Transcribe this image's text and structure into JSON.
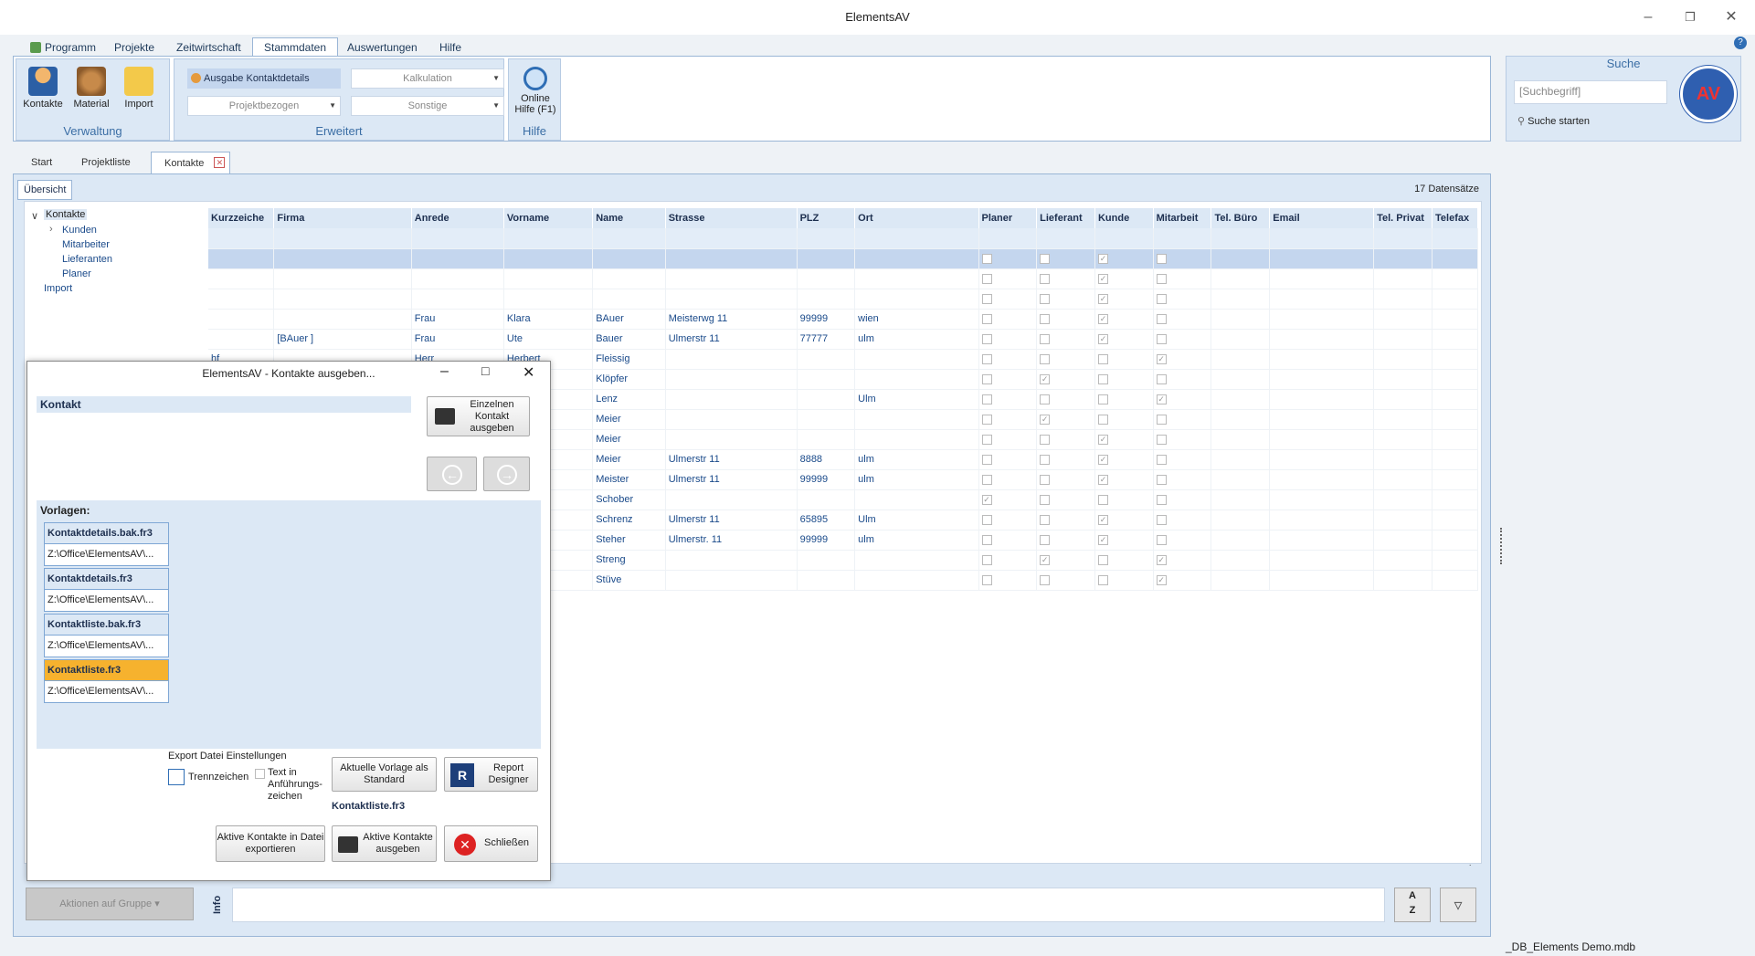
{
  "window": {
    "title": "ElementsAV"
  },
  "menu": [
    "Programm",
    "Projekte",
    "Zeitwirtschaft",
    "Stammdaten",
    "Auswertungen",
    "Hilfe"
  ],
  "ribbon": {
    "verwaltung": {
      "label": "Verwaltung",
      "buttons": [
        "Kontakte",
        "Material",
        "Import"
      ]
    },
    "erweitert": {
      "label": "Erweitert",
      "ausgabe": "Ausgabe Kontaktdetails",
      "kalkulation": "Kalkulation",
      "projektbezogen": "Projektbezogen",
      "sonstige": "Sonstige"
    },
    "hilfe": {
      "label": "Hilfe",
      "online": "Online Hilfe (F1)"
    }
  },
  "search": {
    "title": "Suche",
    "placeholder": "[Suchbegriff]",
    "start": "Suche starten"
  },
  "tabs": [
    "Start",
    "Projektliste",
    "Kontakte"
  ],
  "overview": {
    "tab": "Übersicht",
    "count": "17 Datensätze"
  },
  "tree": {
    "root": "Kontakte",
    "items": [
      "Kunden",
      "Mitarbeiter",
      "Lieferanten",
      "Planer"
    ],
    "import": "Import"
  },
  "grid": {
    "headers": [
      "Kurzzeiche",
      "Firma",
      "Anrede",
      "Vorname",
      "Name",
      "Strasse",
      "PLZ",
      "Ort",
      "Planer",
      "Lieferant",
      "Kunde",
      "Mitarbeit",
      "Tel. Büro",
      "Email",
      "Tel. Privat",
      "Telefax"
    ],
    "rows": [
      [
        "",
        "",
        "",
        "",
        "",
        "",
        "",
        "",
        "",
        "",
        "x",
        ""
      ],
      [
        "",
        "",
        "",
        "",
        "",
        "",
        "",
        "",
        "",
        "",
        "x",
        ""
      ],
      [
        "",
        "",
        "Frau",
        "Klara",
        "BAuer",
        "Meisterwg 11",
        "99999",
        "wien",
        "",
        "",
        "x",
        ""
      ],
      [
        "",
        "[BAuer ]",
        "Frau",
        "Ute",
        "Bauer",
        "Ulmerstr 11",
        "77777",
        "ulm",
        "",
        "",
        "x",
        ""
      ],
      [
        "hf",
        "",
        "Herr",
        "Herbert",
        "Fleissig",
        "",
        "",
        "",
        "",
        "",
        "",
        "x"
      ],
      [
        "",
        "",
        "",
        "",
        "Klöpfer",
        "",
        "",
        "",
        "",
        "x",
        "",
        ""
      ],
      [
        "",
        "",
        "",
        "",
        "Lenz",
        "",
        "",
        "Ulm",
        "",
        "",
        "",
        "x"
      ],
      [
        "",
        "",
        "",
        "",
        "Meier",
        "",
        "",
        "",
        "",
        "x",
        "",
        ""
      ],
      [
        "",
        "",
        "",
        "",
        "Meier",
        "",
        "",
        "",
        "",
        "",
        "x",
        ""
      ],
      [
        "",
        "",
        "",
        "",
        "Meier",
        "Ulmerstr 11",
        "8888",
        "ulm",
        "",
        "",
        "x",
        ""
      ],
      [
        "",
        "",
        "",
        "",
        "Meister",
        "Ulmerstr 11",
        "99999",
        "ulm",
        "",
        "",
        "x",
        ""
      ],
      [
        "",
        "",
        "",
        "",
        "Schober",
        "",
        "",
        "",
        "x",
        "",
        "",
        ""
      ],
      [
        "",
        "",
        "",
        "",
        "Schrenz",
        "Ulmerstr 11",
        "65895",
        "Ulm",
        "",
        "",
        "x",
        ""
      ],
      [
        "",
        "",
        "",
        "",
        "Steher",
        "Ulmerstr. 11",
        "99999",
        "ulm",
        "",
        "",
        "x",
        ""
      ],
      [
        "",
        "",
        "",
        "",
        "Streng",
        "",
        "",
        "",
        "",
        "x",
        "",
        "x"
      ],
      [
        "",
        "",
        "",
        "",
        "Stüve",
        "",
        "",
        "",
        "",
        "",
        "",
        "x"
      ]
    ]
  },
  "dialog": {
    "title": "ElementsAV - Kontakte ausgeben...",
    "kontakt_label": "Kontakt",
    "einzeln": "Einzelnen Kontakt ausgeben",
    "vorlagen": "Vorlagen:",
    "templates": [
      {
        "name": "Kontaktdetails.bak.fr3",
        "path": "Z:\\Office\\ElementsAV\\..."
      },
      {
        "name": "Kontaktdetails.fr3",
        "path": "Z:\\Office\\ElementsAV\\..."
      },
      {
        "name": "Kontaktliste.bak.fr3",
        "path": "Z:\\Office\\ElementsAV\\..."
      },
      {
        "name": "Kontaktliste.fr3",
        "path": "Z:\\Office\\ElementsAV\\..."
      }
    ],
    "export_label": "Export Datei Einstellungen",
    "trennzeichen": "Trennzeichen",
    "text_quotes": "Text in Anführungs-zeichen",
    "aktuelle": "Aktuelle Vorlage als Standard",
    "report": "Report Designer",
    "current_tpl": "Kontaktliste.fr3",
    "export_btn": "Aktive Kontakte in Datei exportieren",
    "ausgeben_btn": "Aktive Kontakte ausgeben",
    "close_btn": "Schließen"
  },
  "bottom": {
    "aktionen": "Aktionen auf Gruppe",
    "info": "Info"
  },
  "status": "_DB_Elements Demo.mdb"
}
